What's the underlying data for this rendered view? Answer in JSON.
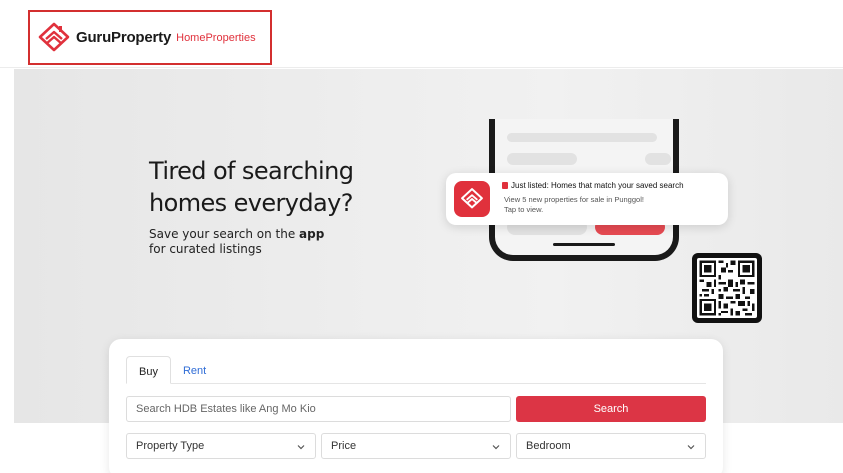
{
  "header": {
    "brand": "GuruProperty",
    "sub_brand": "HomeProperties",
    "logo_icon": "house-logo-icon"
  },
  "hero": {
    "title_line1": "Tired of searching",
    "title_line2": "homes everyday?",
    "subtitle_prefix": "Save your search on the ",
    "subtitle_bold": "app",
    "subtitle_line2": "for curated listings"
  },
  "notification": {
    "title": "Just listed: Homes that match your saved search",
    "line1": "View 5 new properties for sale in Punggol!",
    "line2": "Tap to view."
  },
  "search": {
    "tabs": [
      {
        "label": "Buy",
        "active": true
      },
      {
        "label": "Rent",
        "active": false
      }
    ],
    "input_placeholder": "Search HDB Estates like Ang Mo Kio",
    "button_label": "Search",
    "filters": {
      "property_type": "Property Type",
      "price": "Price",
      "bedroom": "Bedroom"
    }
  },
  "colors": {
    "accent": "#dc3545",
    "brand_red": "#e0313c",
    "link_blue": "#2f6cd6"
  }
}
